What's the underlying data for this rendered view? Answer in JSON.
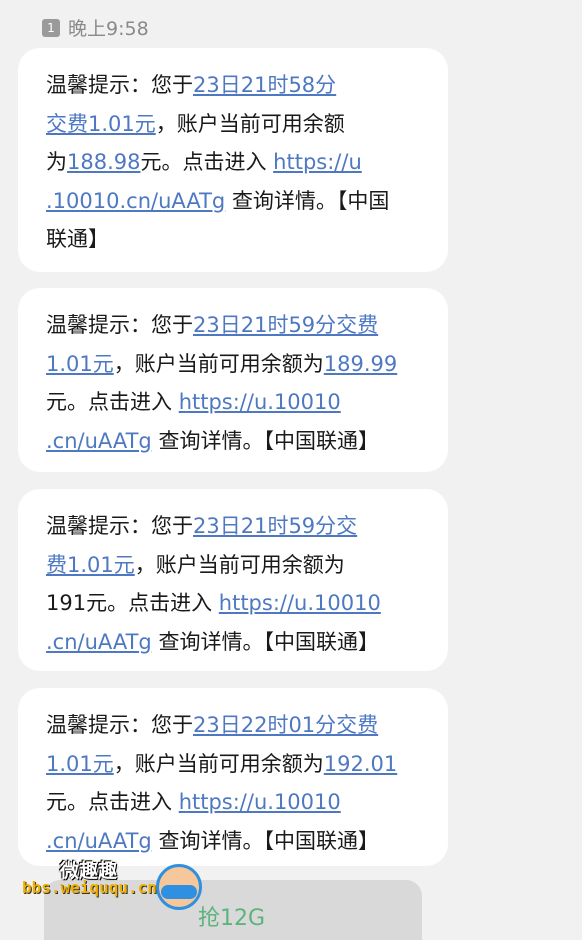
{
  "status_bar": {
    "sim_slot": "1",
    "time": "晚上9:58"
  },
  "messages": [
    {
      "prefix": "温馨提示：您于",
      "datetime": "23日21时58分",
      "fee_link": "交费1.01元",
      "mid": "，账户当前可用余额",
      "balance_prefix": "为",
      "balance": "188.98",
      "suffix": "元。点击进入",
      "url_part1": "https://u",
      "url_part2": ".10010.cn/uAATg",
      "tail": "查询详情。【中国",
      "tail2": "联通】"
    },
    {
      "prefix": "温馨提示：您于",
      "datetime_fee": "23日21时59分交费",
      "fee": "1.01元",
      "mid": "，账户当前可用余额为",
      "balance": "189.99",
      "suffix": "元。点击进入",
      "url_part1": "https://u.10010",
      "url_part2": ".cn/uAATg",
      "tail": "查询详情。【中国联通】"
    },
    {
      "prefix": "温馨提示：您于",
      "datetime": "23日21时59分交",
      "fee": "费1.01元",
      "mid": "，账户当前可用余额为",
      "balance_line": "191元。点击进入",
      "url_part1": "https://u.10010",
      "url_part2": ".cn/uAATg",
      "tail": "查询详情。【中国联通】"
    },
    {
      "prefix": "温馨提示：您于",
      "datetime_fee": "23日22时01分交费",
      "fee": "1.01元",
      "mid": "，账户当前可用余额为",
      "balance": "192.01",
      "suffix": "元。点击进入",
      "url_part1": "https://u.10010",
      "url_part2": ".cn/uAATg",
      "tail": "查询详情。【中国联通】"
    }
  ],
  "promo": {
    "label": "抢12G"
  },
  "watermark": {
    "title": "微趣趣",
    "site": "bbs.weiququ.cn"
  },
  "colors": {
    "link": "#4e78c2",
    "bubble": "#ffffff",
    "background": "#f1f1f1"
  }
}
